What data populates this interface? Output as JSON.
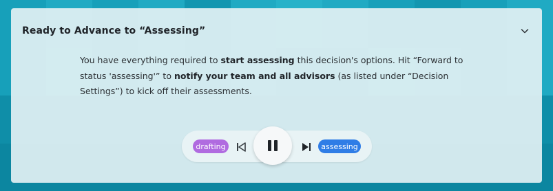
{
  "panel": {
    "title": "Ready to Advance to “Assessing”",
    "collapse_icon": "chevron-down-icon",
    "message": {
      "p1": "You have everything required to ",
      "b1": "start assessing",
      "p2": " this decision's options. Hit “Forward to status 'assessing'” to ",
      "b2": "notify your team and all advisors",
      "p3": " (as listed under “Decision Settings”) to kick off their assessments."
    }
  },
  "player": {
    "from_status": "drafting",
    "to_status": "assessing",
    "prev_icon": "skip-back-icon",
    "pause_icon": "pause-icon",
    "next_icon": "skip-forward-icon"
  },
  "colors": {
    "from_chip": "#b06be0",
    "to_chip": "#2f7de6",
    "background": "#1aa3bd"
  }
}
